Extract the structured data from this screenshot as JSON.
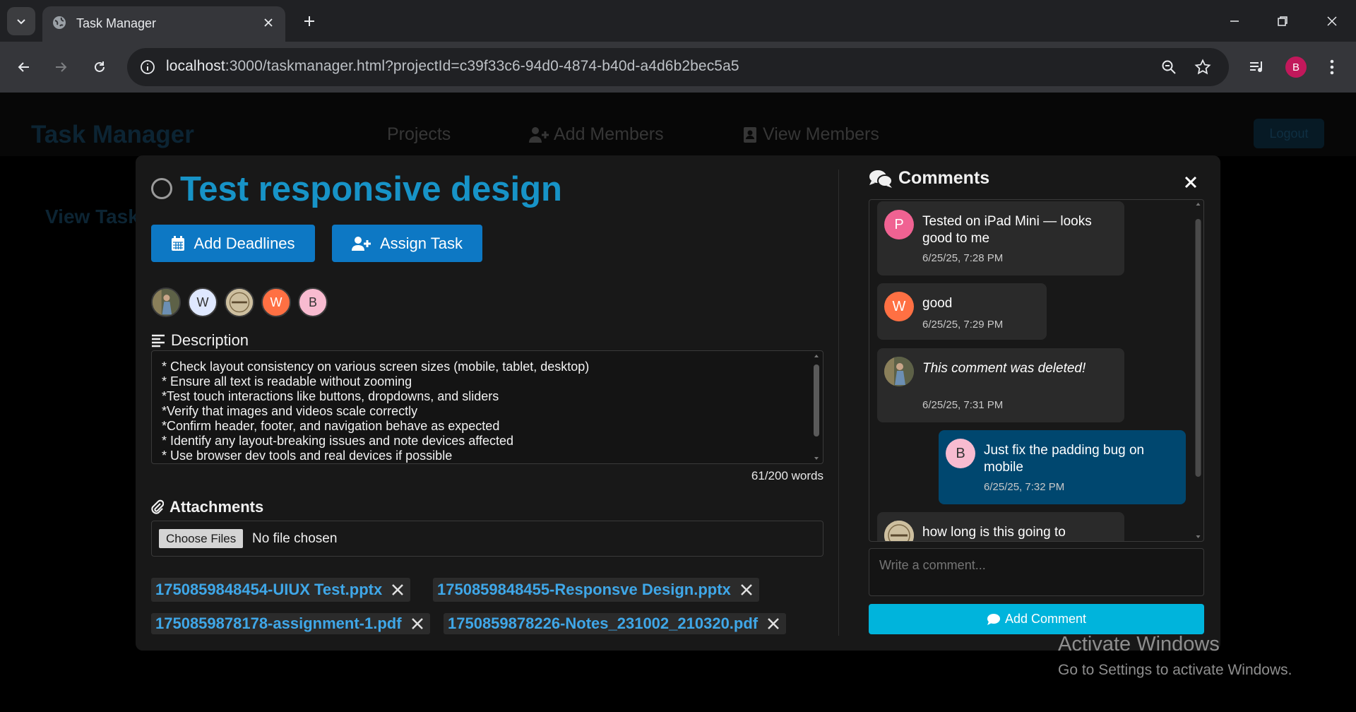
{
  "browser": {
    "tab_title": "Task Manager",
    "url_host": "localhost",
    "url_rest": ":3000/taskmanager.html?projectId=c39f33c6-94d0-4874-b40d-a4d6b2bec5a5",
    "profile_initial": "B"
  },
  "app": {
    "brand": "Task Manager",
    "nav": {
      "projects": "Projects",
      "add_members": "Add Members",
      "view_members": "View Members",
      "logout": "Logout"
    },
    "background_heading": "View Task"
  },
  "task": {
    "title": "Test responsive design",
    "add_deadlines_label": "Add Deadlines",
    "assign_task_label": "Assign Task",
    "members": [
      {
        "initial": "",
        "kind": "photo-person",
        "bg": "#6b6b55"
      },
      {
        "initial": "W",
        "kind": "letter",
        "bg": "#dfe8ff",
        "fg": "#333"
      },
      {
        "initial": "",
        "kind": "photo-logo",
        "bg": "#c9b99a"
      },
      {
        "initial": "W",
        "kind": "letter",
        "bg": "#ff7043",
        "fg": "#fff"
      },
      {
        "initial": "B",
        "kind": "letter",
        "bg": "#f8bbd0",
        "fg": "#333"
      }
    ],
    "description_heading": "Description",
    "description_lines": [
      "* Check layout consistency on various screen sizes (mobile, tablet, desktop)",
      "* Ensure all text is readable without zooming",
      "*Test touch interactions like buttons, dropdowns, and sliders",
      "*Verify that images and videos scale correctly",
      "*Confirm header, footer, and navigation behave as expected",
      "* Identify any layout-breaking issues and note devices affected",
      "* Use browser dev tools and real devices if possible"
    ],
    "word_count": "61/200 words",
    "attachments_heading": "Attachments",
    "file_button": "Choose Files",
    "file_status": "No file chosen",
    "attachments": [
      "1750859848454-UIUX Test.pptx",
      "1750859848455-Responsve Design.pptx",
      "1750859878178-assignment-1.pdf",
      "1750859878226-Notes_231002_210320.pdf"
    ]
  },
  "comments": {
    "heading": "Comments",
    "items": [
      {
        "author_initial": "P",
        "avatar_bg": "#f06292",
        "text": "Tested on iPad Mini — looks good to me",
        "time": "6/25/25, 7:28 PM",
        "mine": false,
        "deleted": false
      },
      {
        "author_initial": "W",
        "avatar_bg": "#ff7043",
        "text": "good",
        "time": "6/25/25, 7:29 PM",
        "mine": false,
        "deleted": false
      },
      {
        "author_initial": "",
        "avatar_bg": "#6b6b55",
        "text": "This comment was deleted!",
        "time": "6/25/25, 7:31 PM",
        "mine": false,
        "deleted": true
      },
      {
        "author_initial": "B",
        "avatar_bg": "#f8bbd0",
        "text": "Just fix the padding bug on mobile",
        "time": "6/25/25, 7:32 PM",
        "mine": true,
        "deleted": false
      },
      {
        "author_initial": "",
        "avatar_bg": "#c9b99a",
        "text": "how long is this going to",
        "time": "",
        "mine": false,
        "deleted": false
      }
    ],
    "input_placeholder": "Write a comment...",
    "add_button": "Add Comment"
  },
  "watermark": {
    "line1": "Activate Windows",
    "line2": "Go to Settings to activate Windows."
  },
  "colors": {
    "accent": "#0d78c4",
    "title": "#1793c7",
    "link": "#3fa7e8",
    "add_comment": "#00b4dc",
    "my_bubble": "#00476f"
  }
}
